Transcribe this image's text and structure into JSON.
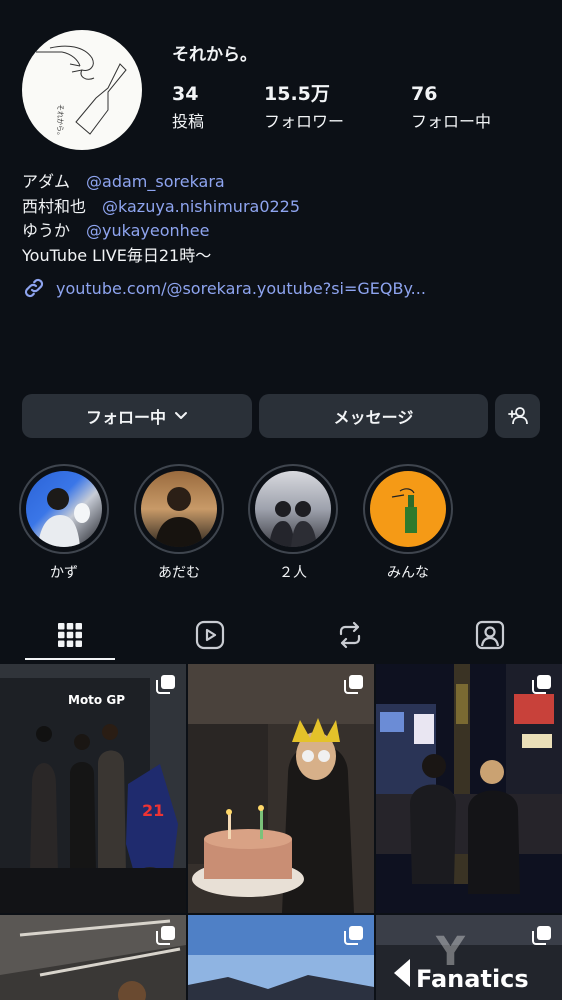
{
  "profile": {
    "name": "それから。",
    "avatar_text": "それから。",
    "stats": [
      {
        "value": "34",
        "label": "投稿"
      },
      {
        "value": "15.5万",
        "label": "フォロワー"
      },
      {
        "value": "76",
        "label": "フォロー中"
      }
    ]
  },
  "bio": {
    "members": [
      {
        "name": "アダム",
        "handle": "@adam_sorekara"
      },
      {
        "name": "西村和也",
        "handle": "@kazuya.nishimura0225"
      },
      {
        "name": "ゆうか",
        "handle": "@yukayeonhee"
      }
    ],
    "tagline": "YouTube LIVE毎日21時〜",
    "link": "youtube.com/@sorekara.youtube?si=GEQBy..."
  },
  "actions": {
    "following_label": "フォロー中",
    "message_label": "メッセージ"
  },
  "highlights": [
    {
      "label": "かず"
    },
    {
      "label": "あだむ"
    },
    {
      "label": "２人"
    },
    {
      "label": "みんな"
    }
  ],
  "tabs": [
    "grid-icon",
    "reels-icon",
    "reposts-icon",
    "tagged-icon"
  ],
  "grid": {
    "cell1_text": "Moto GP",
    "cell3_text": "Fanatics",
    "cell4_text": "Y"
  },
  "colors": {
    "background": "#0c1016",
    "link": "#8ea4ef",
    "button": "#2a3038",
    "highlight_orange": "#f59a16"
  }
}
